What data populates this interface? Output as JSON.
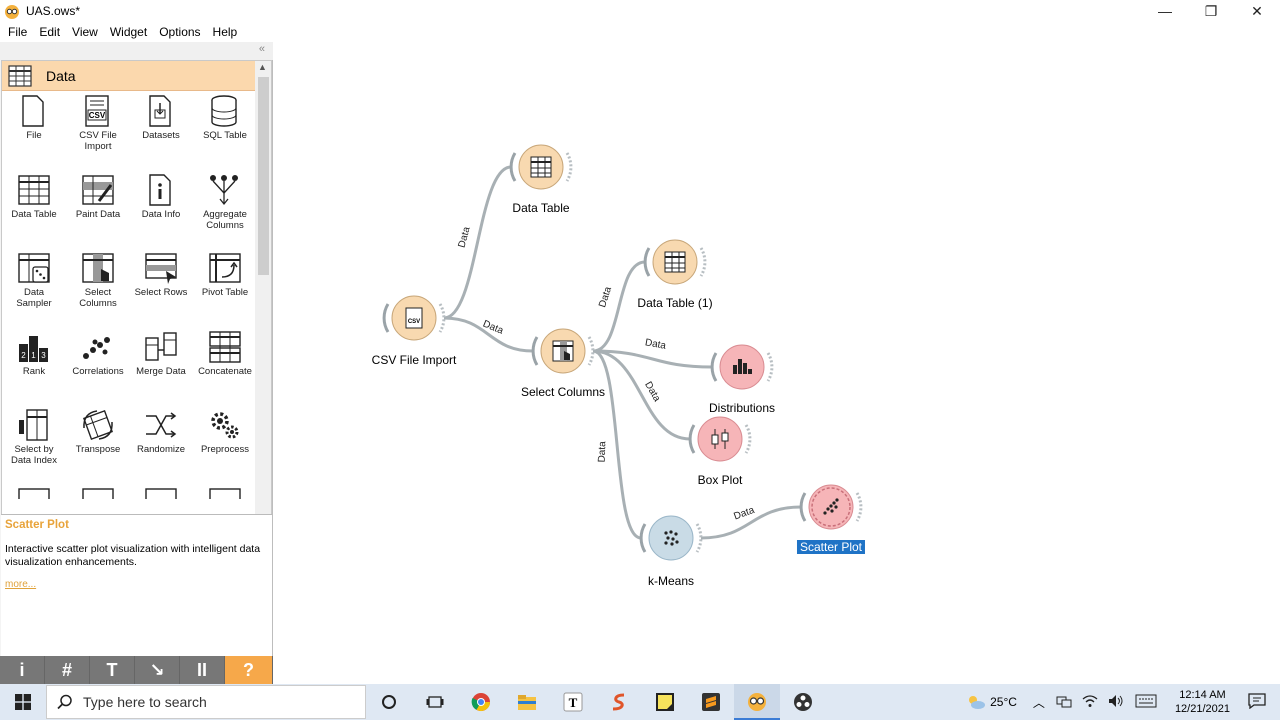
{
  "window": {
    "title": "UAS.ows*",
    "minimize": "—",
    "restore": "❐",
    "close": "✕"
  },
  "menu": [
    "File",
    "Edit",
    "View",
    "Widget",
    "Options",
    "Help"
  ],
  "panel": {
    "collapse": "«",
    "category": "Data",
    "widgets": [
      {
        "label": "File"
      },
      {
        "label": "CSV File\nImport"
      },
      {
        "label": "Datasets"
      },
      {
        "label": "SQL Table"
      },
      {
        "label": "Data Table"
      },
      {
        "label": "Paint Data"
      },
      {
        "label": "Data Info"
      },
      {
        "label": "Aggregate\nColumns"
      },
      {
        "label": "Data\nSampler"
      },
      {
        "label": "Select\nColumns"
      },
      {
        "label": "Select Rows"
      },
      {
        "label": "Pivot Table"
      },
      {
        "label": "Rank"
      },
      {
        "label": "Correlations"
      },
      {
        "label": "Merge Data"
      },
      {
        "label": "Concatenate"
      },
      {
        "label": "Select by\nData Index"
      },
      {
        "label": "Transpose"
      },
      {
        "label": "Randomize"
      },
      {
        "label": "Preprocess"
      }
    ],
    "description": {
      "title": "Scatter Plot",
      "text": "Interactive scatter plot visualization with intelligent data visualization enhancements.",
      "more": "more..."
    },
    "toolbar": [
      "i",
      "#",
      "T",
      "↘",
      "II",
      "?"
    ]
  },
  "canvas": {
    "nodes": [
      {
        "id": "csv",
        "label": "CSV File Import"
      },
      {
        "id": "dt",
        "label": "Data Table"
      },
      {
        "id": "sc",
        "label": "Select Columns"
      },
      {
        "id": "dt1",
        "label": "Data Table (1)"
      },
      {
        "id": "dist",
        "label": "Distributions"
      },
      {
        "id": "box",
        "label": "Box Plot"
      },
      {
        "id": "km",
        "label": "k-Means"
      },
      {
        "id": "sp",
        "label": "Scatter Plot"
      }
    ],
    "link_label": "Data"
  },
  "taskbar": {
    "search_placeholder": "Type here to search",
    "temperature": "25°C",
    "time": "12:14 AM",
    "date": "12/21/2021"
  },
  "colors": {
    "data_node": "#f8d9b0",
    "viz_node": "#f6b5b8",
    "model_node": "#c9dbe6",
    "selection": "#1f73c6"
  }
}
